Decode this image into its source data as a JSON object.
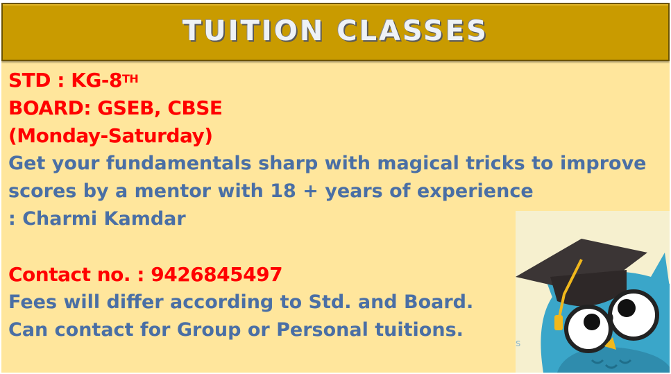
{
  "banner": {
    "title": "TUITION CLASSES"
  },
  "info": {
    "std_prefix": "STD : KG-8",
    "std_sup": "TH",
    "board": "BOARD: GSEB, CBSE",
    "days": "(Monday-Saturday)",
    "desc_line1": "Get your fundamentals sharp with magical tricks to improve",
    "desc_line2": "scores by a mentor with 18 + years of experience",
    "mentor": ": Charmi Kamdar",
    "contact": "Contact no. : 9426845497",
    "fees": "Fees will differ according to Std. and Board.",
    "group": "Can contact for Group or Personal tuitions."
  },
  "colors": {
    "background": "#ffe69c",
    "banner": "#c99b00",
    "red_text": "#ff0000",
    "blue_text": "#4a6fa5"
  },
  "illustration": {
    "icon": "owl-graduation-cap-icon"
  }
}
